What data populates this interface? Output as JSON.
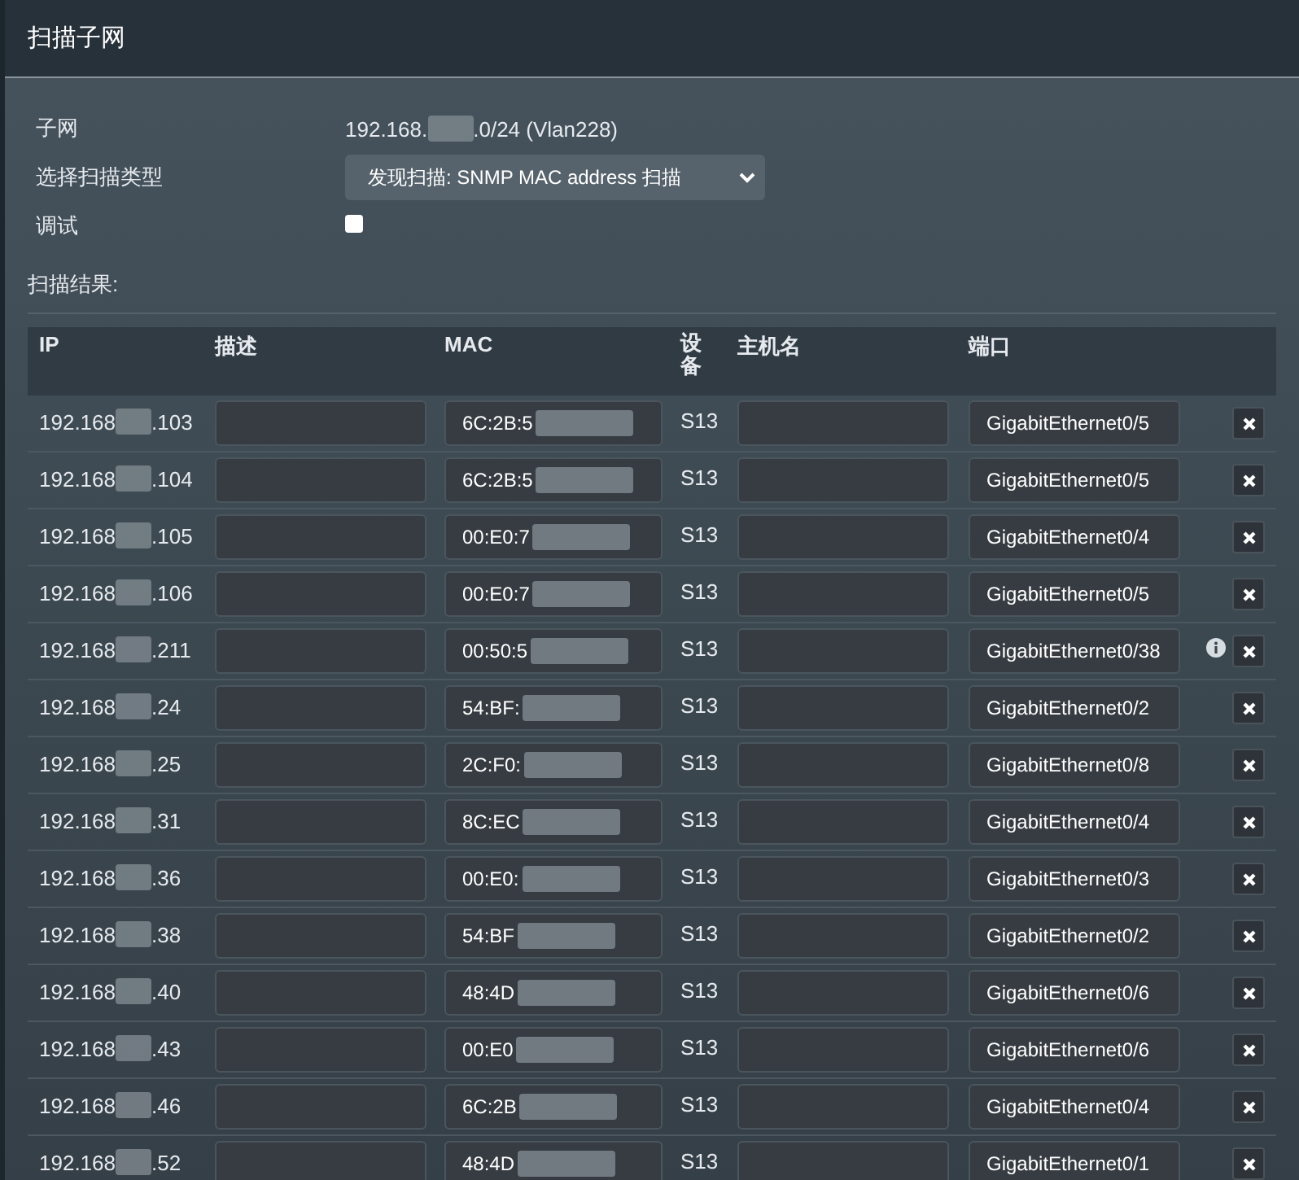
{
  "window": {
    "title": "扫描子网"
  },
  "form": {
    "subnet_label": "子网",
    "subnet_start": "192.168.",
    "subnet_end": ".0/24 (Vlan228)",
    "scan_type_label": "选择扫描类型",
    "scan_type": "发现扫描: SNMP MAC address 扫描",
    "debug_label": "调试",
    "debug_checked": false
  },
  "results_label": "扫描结果:",
  "table": {
    "columns": [
      "IP",
      "描述",
      "MAC",
      "设备",
      "主机名",
      "端口"
    ],
    "rows": [
      {
        "ip_start": "192.168",
        "ip_end": ".103",
        "mac": "6C:2B:5",
        "device": "S13",
        "port": "GigabitEthernet0/5",
        "info": false
      },
      {
        "ip_start": "192.168",
        "ip_end": ".104",
        "mac": "6C:2B:5",
        "device": "S13",
        "port": "GigabitEthernet0/5",
        "info": false
      },
      {
        "ip_start": "192.168",
        "ip_end": ".105",
        "mac": "00:E0:7",
        "device": "S13",
        "port": "GigabitEthernet0/4",
        "info": false
      },
      {
        "ip_start": "192.168",
        "ip_end": ".106",
        "mac": "00:E0:7",
        "device": "S13",
        "port": "GigabitEthernet0/5",
        "info": false
      },
      {
        "ip_start": "192.168",
        "ip_end": ".211",
        "mac": "00:50:5",
        "device": "S13",
        "port": "GigabitEthernet0/38",
        "info": true
      },
      {
        "ip_start": "192.168",
        "ip_end": ".24",
        "mac": "54:BF:",
        "device": "S13",
        "port": "GigabitEthernet0/2",
        "info": false
      },
      {
        "ip_start": "192.168",
        "ip_end": ".25",
        "mac": "2C:F0:",
        "device": "S13",
        "port": "GigabitEthernet0/8",
        "info": false
      },
      {
        "ip_start": "192.168",
        "ip_end": ".31",
        "mac": "8C:EC",
        "device": "S13",
        "port": "GigabitEthernet0/4",
        "info": false
      },
      {
        "ip_start": "192.168",
        "ip_end": ".36",
        "mac": "00:E0:",
        "device": "S13",
        "port": "GigabitEthernet0/3",
        "info": false
      },
      {
        "ip_start": "192.168",
        "ip_end": ".38",
        "mac": "54:BF",
        "device": "S13",
        "port": "GigabitEthernet0/2",
        "info": false
      },
      {
        "ip_start": "192.168",
        "ip_end": ".40",
        "mac": "48:4D",
        "device": "S13",
        "port": "GigabitEthernet0/6",
        "info": false
      },
      {
        "ip_start": "192.168",
        "ip_end": ".43",
        "mac": "00:E0",
        "device": "S13",
        "port": "GigabitEthernet0/6",
        "info": false
      },
      {
        "ip_start": "192.168",
        "ip_end": ".46",
        "mac": "6C:2B",
        "device": "S13",
        "port": "GigabitEthernet0/4",
        "info": false
      },
      {
        "ip_start": "192.168",
        "ip_end": ".52",
        "mac": "48:4D",
        "device": "S13",
        "port": "GigabitEthernet0/1",
        "info": false
      }
    ]
  }
}
